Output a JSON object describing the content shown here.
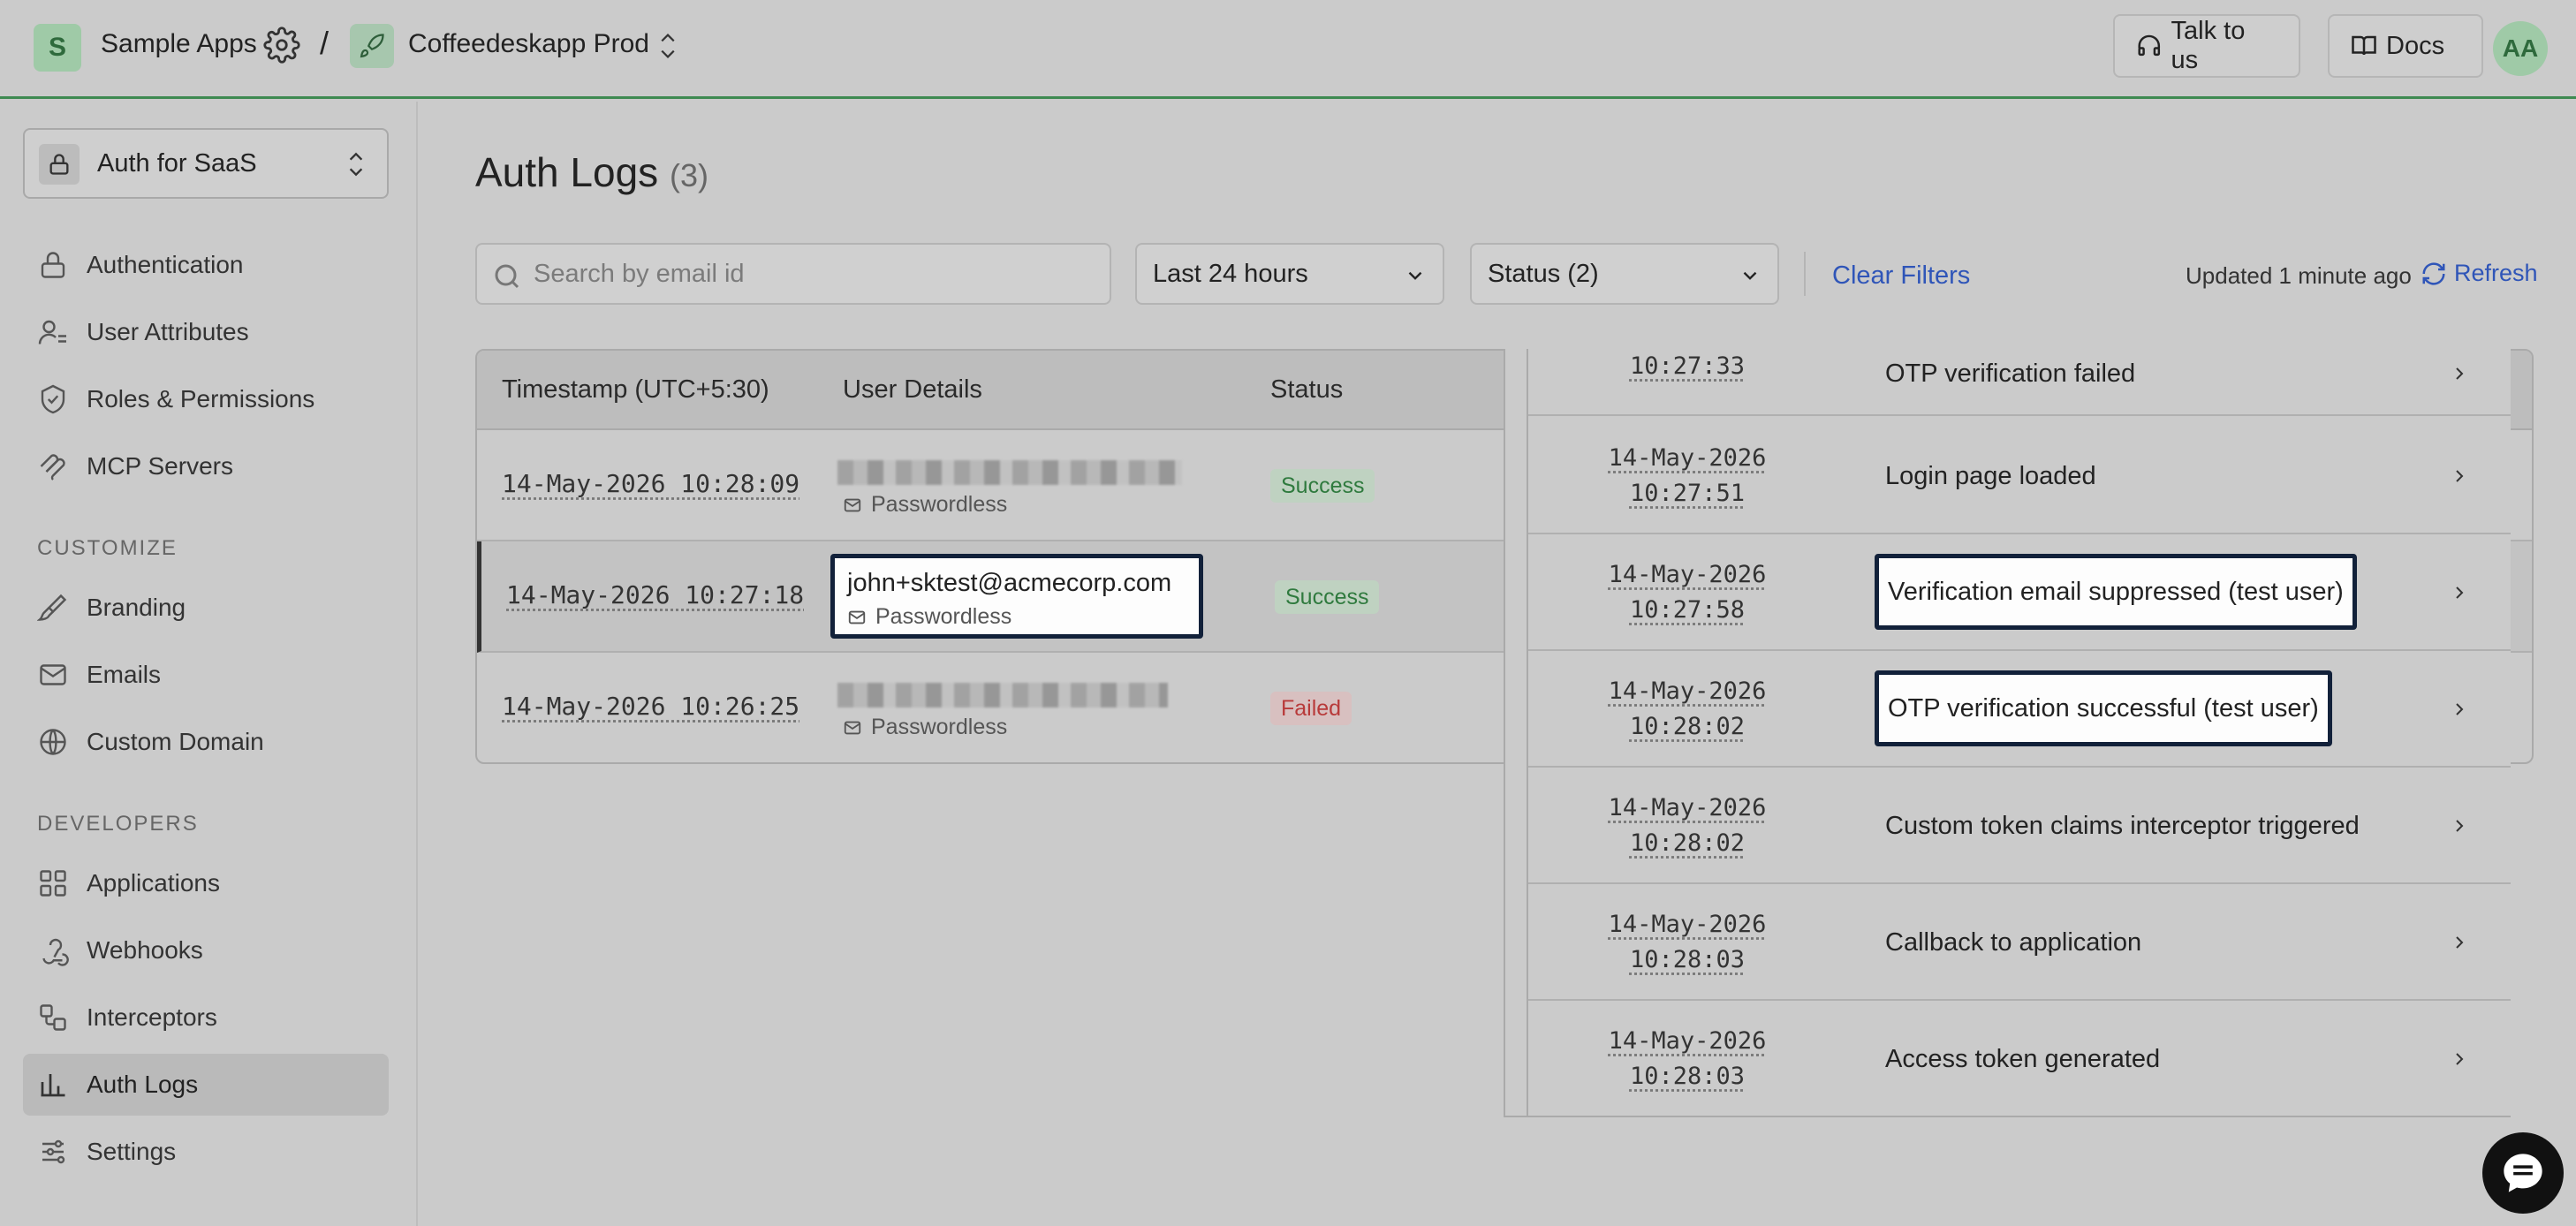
{
  "topbar": {
    "org_initial": "S",
    "org_name": "Sample Apps",
    "separator": "/",
    "app_name": "Coffeedeskapp Prod",
    "talk_label": "Talk to us",
    "docs_label": "Docs",
    "avatar_initials": "AA"
  },
  "sidebar": {
    "env_label": "Auth for SaaS",
    "items_top": [
      {
        "label": "Authentication",
        "icon": "lock-icon"
      },
      {
        "label": "User Attributes",
        "icon": "user-attributes-icon"
      },
      {
        "label": "Roles & Permissions",
        "icon": "shield-check-icon"
      },
      {
        "label": "MCP Servers",
        "icon": "mcp-icon"
      }
    ],
    "customize_heading": "CUSTOMIZE",
    "items_customize": [
      {
        "label": "Branding",
        "icon": "brush-icon"
      },
      {
        "label": "Emails",
        "icon": "mail-icon"
      },
      {
        "label": "Custom Domain",
        "icon": "globe-icon"
      }
    ],
    "developers_heading": "DEVELOPERS",
    "items_developers": [
      {
        "label": "Applications",
        "icon": "grid-icon"
      },
      {
        "label": "Webhooks",
        "icon": "webhook-icon"
      },
      {
        "label": "Interceptors",
        "icon": "interceptor-icon"
      },
      {
        "label": "Auth Logs",
        "icon": "bar-chart-icon"
      },
      {
        "label": "Settings",
        "icon": "sliders-icon"
      }
    ],
    "active_item": "Auth Logs"
  },
  "main": {
    "title": "Auth Logs",
    "count": "(3)",
    "search_placeholder": "Search by email id",
    "time_filter": "Last 24 hours",
    "status_filter": "Status (2)",
    "clear_filters": "Clear Filters",
    "updated": "Updated 1 minute ago",
    "refresh": "Refresh"
  },
  "table": {
    "headers": [
      "Timestamp (UTC+5:30)",
      "User Details",
      "Status"
    ],
    "rows": [
      {
        "timestamp": "14-May-2026 10:28:09",
        "email": "",
        "method": "Passwordless",
        "status": "Success"
      },
      {
        "timestamp": "14-May-2026 10:27:18",
        "email": "john+sktest@acmecorp.com",
        "method": "Passwordless",
        "status": "Success"
      },
      {
        "timestamp": "14-May-2026 10:26:25",
        "email": "",
        "method": "Passwordless",
        "status": "Failed"
      }
    ]
  },
  "events": [
    {
      "date": "",
      "time": "10:27:33",
      "label": "OTP verification failed"
    },
    {
      "date": "14-May-2026",
      "time": "10:27:51",
      "label": "Login page loaded"
    },
    {
      "date": "14-May-2026",
      "time": "10:27:58",
      "label": "Verification email suppressed (test user)"
    },
    {
      "date": "14-May-2026",
      "time": "10:28:02",
      "label": "OTP verification successful (test user)"
    },
    {
      "date": "14-May-2026",
      "time": "10:28:02",
      "label": "Custom token claims interceptor triggered"
    },
    {
      "date": "14-May-2026",
      "time": "10:28:03",
      "label": "Callback to application"
    },
    {
      "date": "14-May-2026",
      "time": "10:28:03",
      "label": "Access token generated"
    }
  ],
  "colors": {
    "accent_green": "#3f8a52",
    "link_blue": "#2f55b8",
    "success": "#2f7a3e",
    "failed": "#b83a3a",
    "highlight_border": "#12213a"
  }
}
